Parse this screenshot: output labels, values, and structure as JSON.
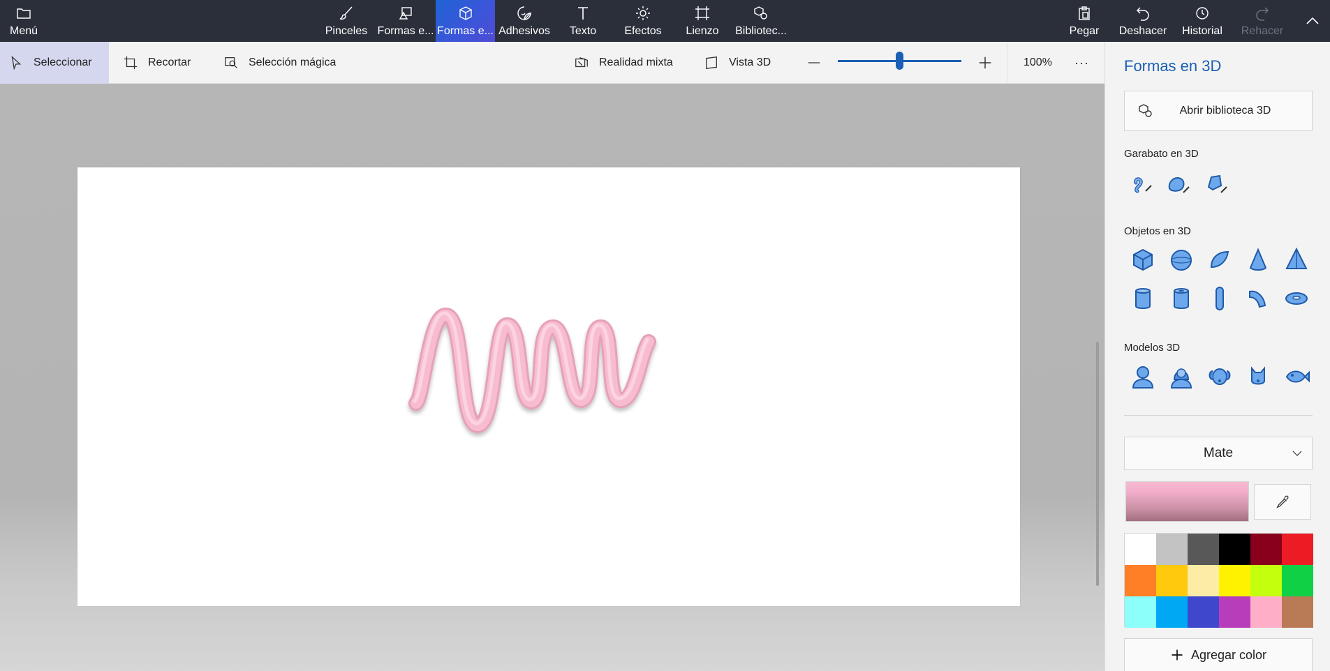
{
  "topbar": {
    "menu_label": "Menú",
    "tools": [
      {
        "label": "Pinceles",
        "icon": "brush-icon"
      },
      {
        "label": "Formas e...",
        "icon": "2d-shapes-icon"
      },
      {
        "label": "Formas e...",
        "icon": "3d-shapes-icon",
        "active": true
      },
      {
        "label": "Adhesivos",
        "icon": "sticker-icon"
      },
      {
        "label": "Texto",
        "icon": "text-icon"
      },
      {
        "label": "Efectos",
        "icon": "effects-icon"
      },
      {
        "label": "Lienzo",
        "icon": "canvas-icon"
      },
      {
        "label": "Bibliotec...",
        "icon": "3d-library-icon"
      }
    ],
    "paste_label": "Pegar",
    "undo_label": "Deshacer",
    "history_label": "Historial",
    "redo_label": "Rehacer"
  },
  "subbar": {
    "select_label": "Seleccionar",
    "crop_label": "Recortar",
    "magic_select_label": "Selección mágica",
    "mixed_reality_label": "Realidad mixta",
    "view3d_label": "Vista 3D",
    "zoom_value": "100%",
    "zoom_slider_fraction": 0.5,
    "more_label": "···"
  },
  "panel": {
    "title": "Formas en 3D",
    "library_button": "Abrir biblioteca 3D",
    "doodle_section": "Garabato en 3D",
    "objects_section": "Objetos en 3D",
    "models_section": "Modelos 3D",
    "material": "Mate",
    "current_color": "#f2aecb",
    "add_color_label": "Agregar color",
    "swatches": [
      "#ffffff",
      "#c3c3c3",
      "#585858",
      "#000000",
      "#88001b",
      "#ec1c24",
      "#ff7f27",
      "#ffc90e",
      "#fdeca6",
      "#fff200",
      "#c4ff0e",
      "#0ed145",
      "#8cfffb",
      "#00a8f3",
      "#3f48cc",
      "#b83dba",
      "#ffaec8",
      "#b97a56"
    ]
  },
  "colors": {
    "accent": "#1a5fb4",
    "topbar_bg": "#2b2f3a",
    "doodle": "#f7b8cf"
  }
}
